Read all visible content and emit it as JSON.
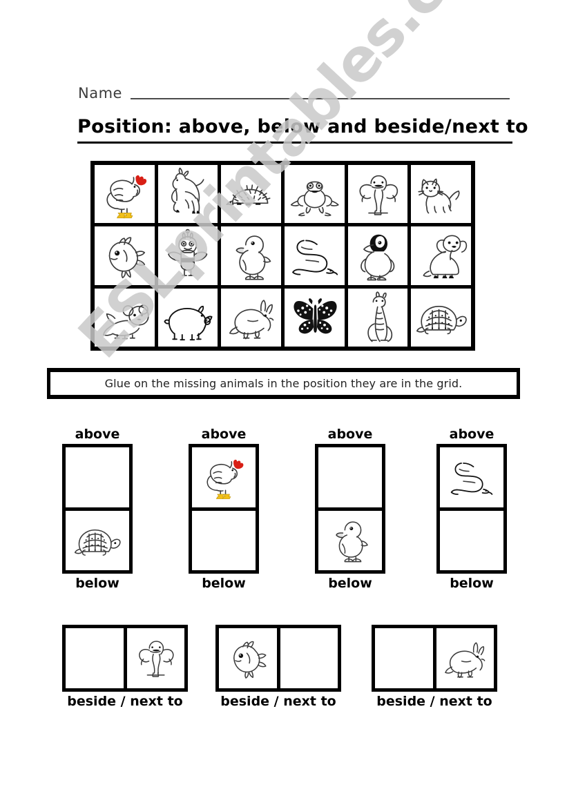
{
  "header": {
    "name_label": "Name",
    "title": "Position: above, below and beside/next to"
  },
  "watermark": "ESLprintables.com",
  "instruction": "Glue on the missing animals in the position they are in the grid.",
  "grid": {
    "rows": 3,
    "cols": 6,
    "cells": [
      {
        "animal": "rooster"
      },
      {
        "animal": "horse"
      },
      {
        "animal": "hedgehog"
      },
      {
        "animal": "frog"
      },
      {
        "animal": "elephant"
      },
      {
        "animal": "cat"
      },
      {
        "animal": "fish"
      },
      {
        "animal": "bee"
      },
      {
        "animal": "duck"
      },
      {
        "animal": "snake"
      },
      {
        "animal": "penguin"
      },
      {
        "animal": "dog"
      },
      {
        "animal": "mouse"
      },
      {
        "animal": "pig"
      },
      {
        "animal": "rabbit"
      },
      {
        "animal": "butterfly"
      },
      {
        "animal": "giraffe"
      },
      {
        "animal": "turtle"
      }
    ]
  },
  "vertical_pairs": {
    "top_label": "above",
    "bottom_label": "below",
    "items": [
      {
        "top": "",
        "bottom": "turtle"
      },
      {
        "top": "rooster",
        "bottom": ""
      },
      {
        "top": "",
        "bottom": "duck"
      },
      {
        "top": "snake",
        "bottom": ""
      }
    ]
  },
  "horizontal_pairs": {
    "label": "beside / next to",
    "items": [
      {
        "left": "",
        "right": "elephant"
      },
      {
        "left": "fish",
        "right": ""
      },
      {
        "left": "",
        "right": "rabbit"
      }
    ]
  },
  "colors": {
    "ink": "#000000",
    "line_art": "#3a3a3a",
    "comb_red": "#d81f15",
    "feet_yellow": "#f2c018",
    "watermark_gray": "#c9c9c9"
  }
}
